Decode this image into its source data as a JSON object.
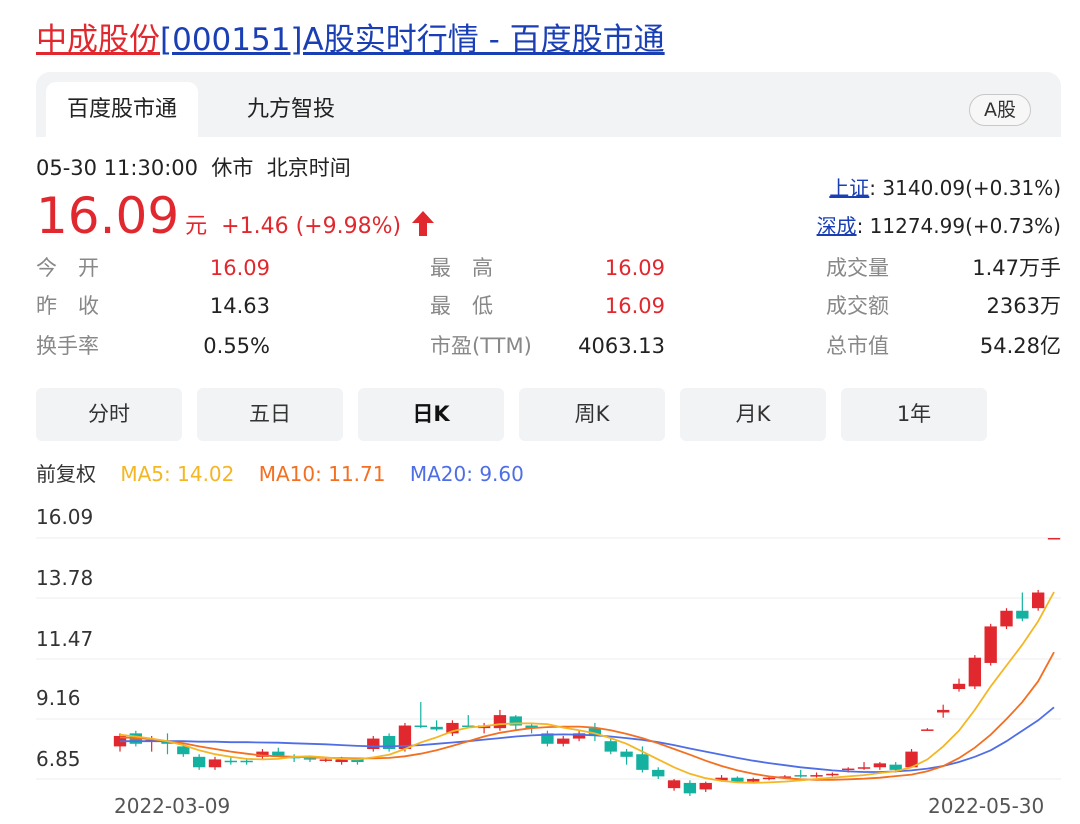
{
  "page_title": {
    "stock_name": "中成股份",
    "rest": "[000151]A股实时行情 - 百度股市通"
  },
  "tabs": [
    {
      "label": "百度股市通",
      "active": true
    },
    {
      "label": "九方智投",
      "active": false
    }
  ],
  "market_tag": "A股",
  "quote": {
    "time": "05-30 11:30:00",
    "status": "休市",
    "timezone": "北京时间",
    "price": "16.09",
    "unit": "元",
    "change": "+1.46 (+9.98%)",
    "direction": "up"
  },
  "indices": [
    {
      "name": "上证",
      "value": ": 3140.09(+0.31%)"
    },
    {
      "name": "深成",
      "value": ": 11274.99(+0.73%)"
    }
  ],
  "stats": [
    {
      "label": "今　开",
      "value": "16.09",
      "color": "red"
    },
    {
      "label": "最　高",
      "value": "16.09",
      "color": "red"
    },
    {
      "label": "成交量",
      "value": "1.47万手",
      "color": "black"
    },
    {
      "label": "昨　收",
      "value": "14.63",
      "color": "black"
    },
    {
      "label": "最　低",
      "value": "16.09",
      "color": "red"
    },
    {
      "label": "成交额",
      "value": "2363万",
      "color": "black"
    },
    {
      "label": "换手率",
      "value": "0.55%",
      "color": "black"
    },
    {
      "label": "市盈(TTM)",
      "value": "4063.13",
      "color": "black"
    },
    {
      "label": "总市值",
      "value": "54.28亿",
      "color": "black"
    }
  ],
  "periods": [
    {
      "label": "分时",
      "active": false
    },
    {
      "label": "五日",
      "active": false
    },
    {
      "label": "日K",
      "active": true
    },
    {
      "label": "周K",
      "active": false
    },
    {
      "label": "月K",
      "active": false
    },
    {
      "label": "1年",
      "active": false
    }
  ],
  "ma_legend": {
    "adjust": "前复权",
    "ma5": "MA5: 14.02",
    "ma10": "MA10: 11.71",
    "ma20": "MA20: 9.60"
  },
  "colors": {
    "up": "#e0282e",
    "down": "#14b1a0",
    "ma5": "#f5b624",
    "ma10": "#f36f21",
    "ma20": "#4f6ee6",
    "link_blue": "#1a3fb5"
  },
  "chart_data": {
    "type": "candlestick",
    "y_ticks": [
      "16.09",
      "13.78",
      "11.47",
      "9.16",
      "6.85"
    ],
    "ylim": [
      6.85,
      16.09
    ],
    "x_labels": [
      "2022-03-09",
      "2022-05-30"
    ],
    "grid": true,
    "candles": [
      {
        "o": 8.1,
        "c": 8.5,
        "h": 8.6,
        "l": 7.9
      },
      {
        "o": 8.6,
        "c": 8.2,
        "h": 8.7,
        "l": 8.1
      },
      {
        "o": 8.3,
        "c": 8.35,
        "h": 8.5,
        "l": 7.9
      },
      {
        "o": 8.3,
        "c": 8.2,
        "h": 8.6,
        "l": 7.8
      },
      {
        "o": 8.1,
        "c": 7.8,
        "h": 8.2,
        "l": 7.7
      },
      {
        "o": 7.7,
        "c": 7.3,
        "h": 7.8,
        "l": 7.2
      },
      {
        "o": 7.3,
        "c": 7.6,
        "h": 7.7,
        "l": 7.2
      },
      {
        "o": 7.55,
        "c": 7.5,
        "h": 7.7,
        "l": 7.4
      },
      {
        "o": 7.55,
        "c": 7.5,
        "h": 7.65,
        "l": 7.4
      },
      {
        "o": 7.7,
        "c": 7.9,
        "h": 8.0,
        "l": 7.6
      },
      {
        "o": 7.9,
        "c": 7.75,
        "h": 8.05,
        "l": 7.7
      },
      {
        "o": 7.7,
        "c": 7.65,
        "h": 7.8,
        "l": 7.5
      },
      {
        "o": 7.65,
        "c": 7.6,
        "h": 7.75,
        "l": 7.5
      },
      {
        "o": 7.55,
        "c": 7.6,
        "h": 7.7,
        "l": 7.5
      },
      {
        "o": 7.5,
        "c": 7.6,
        "h": 7.7,
        "l": 7.4
      },
      {
        "o": 7.6,
        "c": 7.5,
        "h": 7.65,
        "l": 7.4
      },
      {
        "o": 8.0,
        "c": 8.4,
        "h": 8.5,
        "l": 7.9
      },
      {
        "o": 8.5,
        "c": 8.0,
        "h": 8.6,
        "l": 7.9
      },
      {
        "o": 8.0,
        "c": 8.9,
        "h": 9.0,
        "l": 7.9
      },
      {
        "o": 8.9,
        "c": 8.85,
        "h": 9.8,
        "l": 8.8
      },
      {
        "o": 8.85,
        "c": 8.75,
        "h": 9.1,
        "l": 8.7
      },
      {
        "o": 8.6,
        "c": 9.0,
        "h": 9.1,
        "l": 8.5
      },
      {
        "o": 8.9,
        "c": 8.85,
        "h": 9.3,
        "l": 8.8
      },
      {
        "o": 8.8,
        "c": 8.9,
        "h": 9.0,
        "l": 8.6
      },
      {
        "o": 8.8,
        "c": 9.3,
        "h": 9.5,
        "l": 8.7
      },
      {
        "o": 9.25,
        "c": 8.9,
        "h": 9.3,
        "l": 8.7
      },
      {
        "o": 8.9,
        "c": 8.8,
        "h": 9.0,
        "l": 8.6
      },
      {
        "o": 8.6,
        "c": 8.2,
        "h": 8.7,
        "l": 8.1
      },
      {
        "o": 8.2,
        "c": 8.4,
        "h": 8.5,
        "l": 8.1
      },
      {
        "o": 8.4,
        "c": 8.6,
        "h": 8.7,
        "l": 8.3
      },
      {
        "o": 8.8,
        "c": 8.5,
        "h": 9.0,
        "l": 8.3
      },
      {
        "o": 8.3,
        "c": 7.9,
        "h": 8.4,
        "l": 7.8
      },
      {
        "o": 7.9,
        "c": 7.7,
        "h": 8.0,
        "l": 7.4
      },
      {
        "o": 7.8,
        "c": 7.2,
        "h": 8.1,
        "l": 7.1
      },
      {
        "o": 7.2,
        "c": 6.95,
        "h": 7.3,
        "l": 6.85
      },
      {
        "o": 6.5,
        "c": 6.8,
        "h": 6.85,
        "l": 6.4
      },
      {
        "o": 6.7,
        "c": 6.3,
        "h": 6.8,
        "l": 6.2
      },
      {
        "o": 6.45,
        "c": 6.7,
        "h": 6.75,
        "l": 6.35
      },
      {
        "o": 6.8,
        "c": 6.9,
        "h": 7.0,
        "l": 6.75
      },
      {
        "o": 6.9,
        "c": 6.75,
        "h": 6.95,
        "l": 6.7
      },
      {
        "o": 6.75,
        "c": 6.85,
        "h": 6.9,
        "l": 6.7
      },
      {
        "o": 6.85,
        "c": 6.9,
        "h": 6.95,
        "l": 6.8
      },
      {
        "o": 6.9,
        "c": 6.95,
        "h": 7.0,
        "l": 6.85
      },
      {
        "o": 7.0,
        "c": 6.95,
        "h": 7.2,
        "l": 6.9
      },
      {
        "o": 6.95,
        "c": 7.0,
        "h": 7.1,
        "l": 6.9
      },
      {
        "o": 7.0,
        "c": 7.05,
        "h": 7.1,
        "l": 6.95
      },
      {
        "o": 7.2,
        "c": 7.25,
        "h": 7.3,
        "l": 7.1
      },
      {
        "o": 7.25,
        "c": 7.3,
        "h": 7.5,
        "l": 7.2
      },
      {
        "o": 7.3,
        "c": 7.45,
        "h": 7.5,
        "l": 7.2
      },
      {
        "o": 7.4,
        "c": 7.2,
        "h": 7.5,
        "l": 7.1
      },
      {
        "o": 7.3,
        "c": 7.9,
        "h": 8.0,
        "l": 7.3
      },
      {
        "o": 8.7,
        "c": 8.75,
        "h": 8.8,
        "l": 8.7
      },
      {
        "o": 9.4,
        "c": 9.5,
        "h": 9.7,
        "l": 9.2
      },
      {
        "o": 10.3,
        "c": 10.5,
        "h": 10.7,
        "l": 10.2
      },
      {
        "o": 10.4,
        "c": 11.5,
        "h": 11.6,
        "l": 10.3
      },
      {
        "o": 11.3,
        "c": 12.7,
        "h": 12.8,
        "l": 11.2
      },
      {
        "o": 12.7,
        "c": 13.3,
        "h": 13.4,
        "l": 12.6
      },
      {
        "o": 13.3,
        "c": 13.0,
        "h": 14.0,
        "l": 12.9
      },
      {
        "o": 13.4,
        "c": 14.0,
        "h": 14.1,
        "l": 13.3
      },
      {
        "o": 16.09,
        "c": 16.09,
        "h": 16.09,
        "l": 16.09
      }
    ],
    "ma5_values": [
      8.55,
      8.48,
      8.4,
      8.3,
      8.15,
      7.95,
      7.8,
      7.7,
      7.62,
      7.6,
      7.62,
      7.7,
      7.72,
      7.68,
      7.62,
      7.6,
      7.68,
      7.78,
      8.0,
      8.25,
      8.45,
      8.68,
      8.82,
      8.88,
      8.95,
      8.98,
      8.98,
      8.95,
      8.82,
      8.72,
      8.6,
      8.42,
      8.2,
      7.9,
      7.6,
      7.3,
      7.05,
      6.88,
      6.78,
      6.72,
      6.7,
      6.72,
      6.75,
      6.8,
      6.85,
      6.9,
      6.95,
      7.0,
      7.08,
      7.15,
      7.3,
      7.6,
      8.1,
      8.7,
      9.5,
      10.4,
      11.2,
      12.0,
      12.9,
      14.02
    ],
    "ma10_values": [
      8.45,
      8.42,
      8.38,
      8.3,
      8.22,
      8.1,
      8.0,
      7.9,
      7.82,
      7.75,
      7.72,
      7.7,
      7.68,
      7.66,
      7.65,
      7.64,
      7.64,
      7.66,
      7.72,
      7.82,
      7.95,
      8.12,
      8.3,
      8.48,
      8.62,
      8.72,
      8.8,
      8.84,
      8.86,
      8.86,
      8.82,
      8.72,
      8.58,
      8.42,
      8.22,
      8.0,
      7.78,
      7.55,
      7.35,
      7.18,
      7.05,
      6.95,
      6.88,
      6.84,
      6.82,
      6.82,
      6.84,
      6.86,
      6.9,
      6.96,
      7.02,
      7.15,
      7.35,
      7.65,
      8.05,
      8.55,
      9.15,
      9.8,
      10.6,
      11.71
    ],
    "ma20_values": [
      8.3,
      8.3,
      8.3,
      8.3,
      8.3,
      8.28,
      8.28,
      8.26,
      8.26,
      8.25,
      8.24,
      8.22,
      8.2,
      8.18,
      8.15,
      8.12,
      8.1,
      8.1,
      8.12,
      8.15,
      8.2,
      8.25,
      8.3,
      8.36,
      8.42,
      8.48,
      8.52,
      8.55,
      8.56,
      8.55,
      8.52,
      8.48,
      8.42,
      8.35,
      8.26,
      8.15,
      8.02,
      7.9,
      7.78,
      7.66,
      7.55,
      7.46,
      7.38,
      7.3,
      7.24,
      7.18,
      7.14,
      7.12,
      7.12,
      7.14,
      7.18,
      7.25,
      7.35,
      7.5,
      7.7,
      7.95,
      8.3,
      8.7,
      9.1,
      9.6
    ]
  }
}
